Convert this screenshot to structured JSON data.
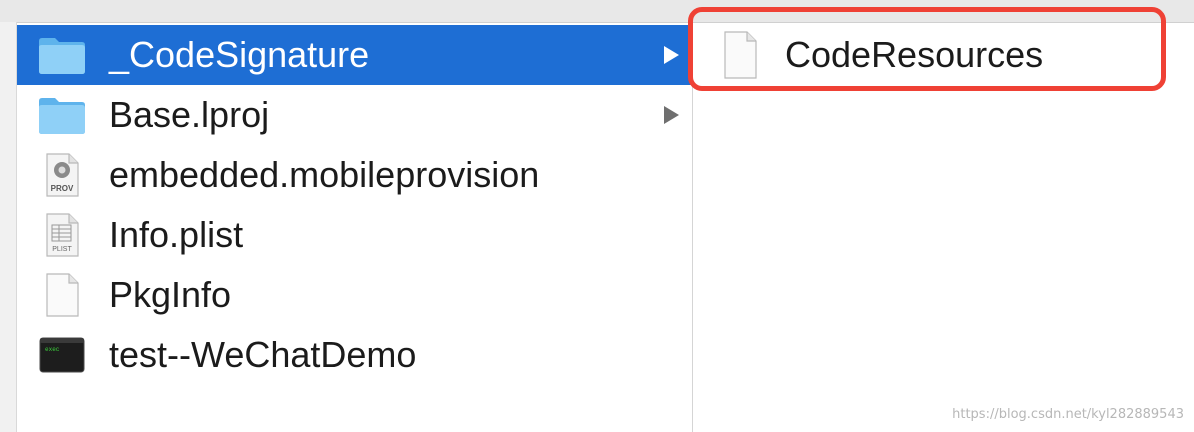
{
  "column1": {
    "items": [
      {
        "label": "_CodeSignature",
        "icon": "folder-icon",
        "selected": true,
        "has_children": true
      },
      {
        "label": "Base.lproj",
        "icon": "folder-icon",
        "selected": false,
        "has_children": true
      },
      {
        "label": "embedded.mobileprovision",
        "icon": "provisioning-profile-icon",
        "icon_text": "PROV",
        "selected": false,
        "has_children": false
      },
      {
        "label": "Info.plist",
        "icon": "plist-file-icon",
        "icon_text": "PLIST",
        "selected": false,
        "has_children": false
      },
      {
        "label": "PkgInfo",
        "icon": "blank-document-icon",
        "selected": false,
        "has_children": false
      },
      {
        "label": "test--WeChatDemo",
        "icon": "executable-icon",
        "icon_text": "exec",
        "selected": false,
        "has_children": false
      }
    ]
  },
  "column2": {
    "items": [
      {
        "label": "CodeResources",
        "icon": "blank-document-icon",
        "highlighted": true
      }
    ]
  },
  "watermark": "https://blog.csdn.net/kyl282889543",
  "colors": {
    "selection": "#1e6ed4",
    "highlight_border": "#ef4135",
    "folder": "#79c4f2"
  }
}
